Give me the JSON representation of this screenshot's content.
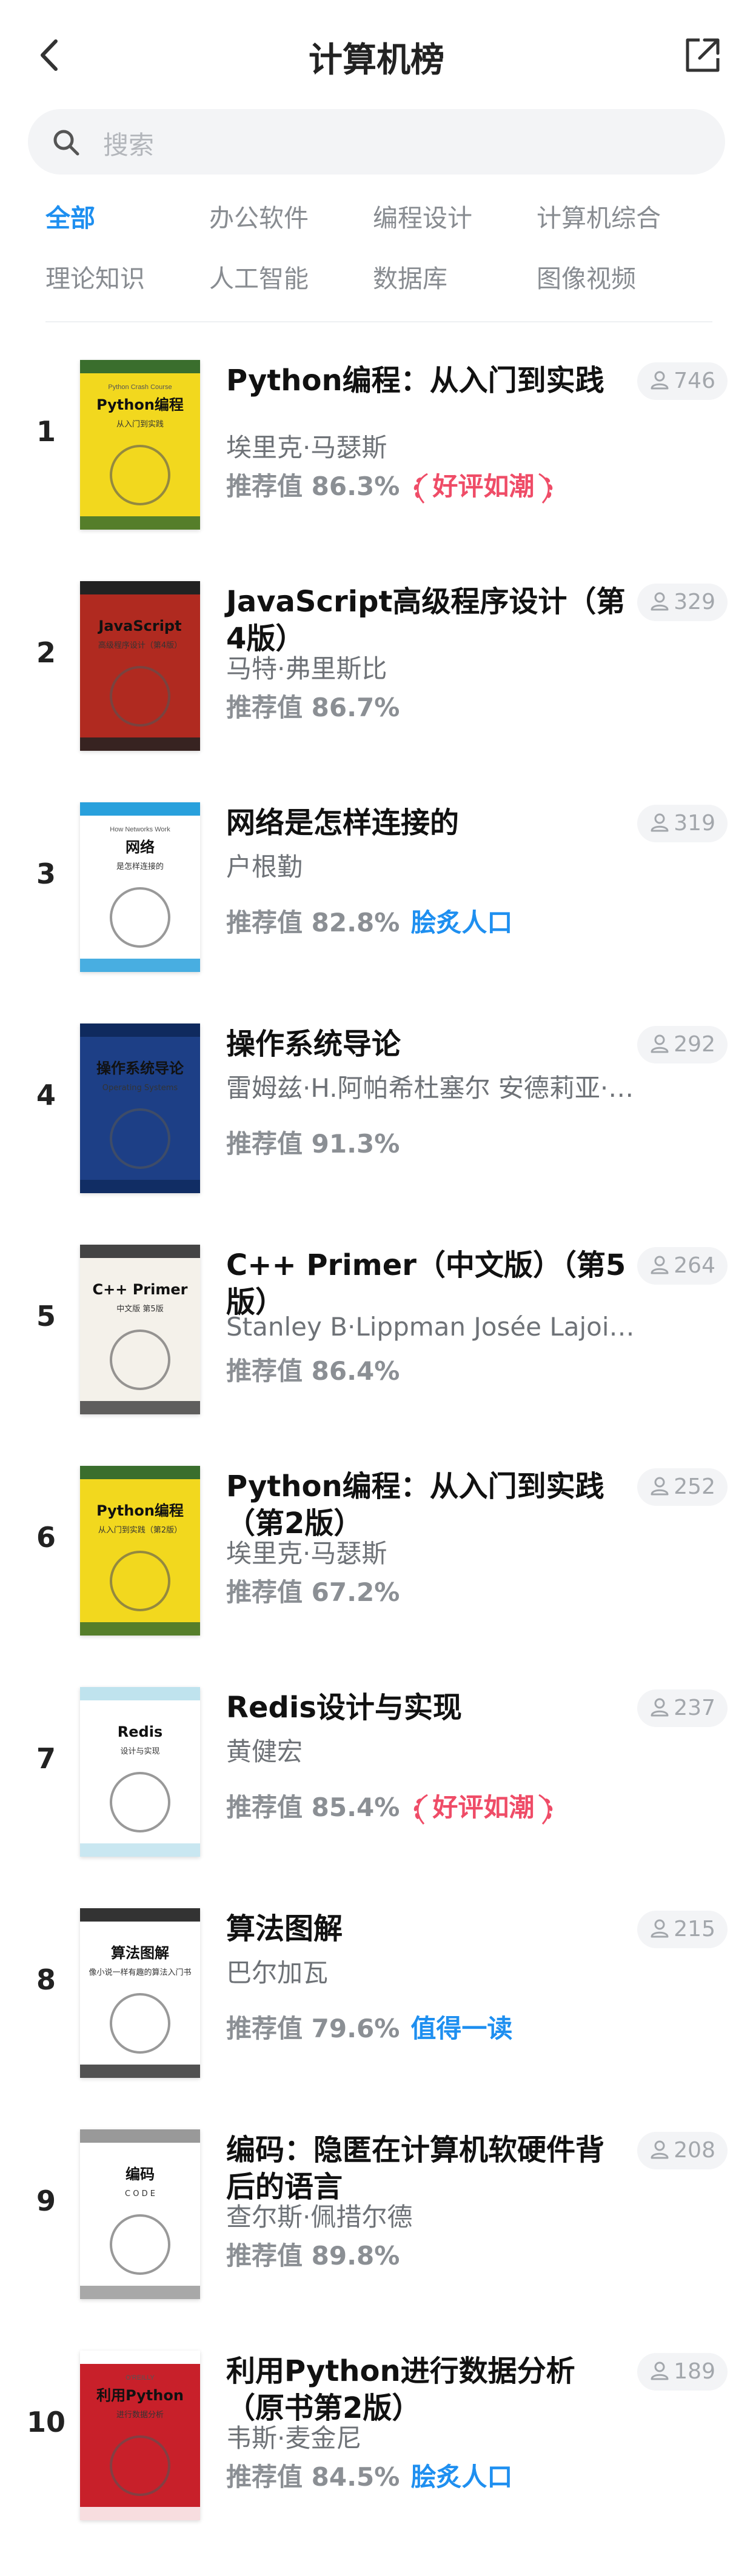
{
  "header": {
    "title": "计算机榜"
  },
  "search": {
    "placeholder": "搜索"
  },
  "categories": [
    "全部",
    "办公软件",
    "编程设计",
    "计算机综合",
    "理论知识",
    "人工智能",
    "数据库",
    "图像视频"
  ],
  "active_category": "全部",
  "books": [
    {
      "rank": "1",
      "title": "Python编程：从入门到实践",
      "author": "埃里克·马瑟斯",
      "score": "推荐值 86.3%",
      "tag": "好评如潮",
      "tag_style": "red",
      "readers": "746",
      "cover": {
        "bg": "#f2d81e",
        "band": "#3a6e2d",
        "title": "Python编程",
        "subtitle": "从入门到实践",
        "top": "Python Crash Course"
      }
    },
    {
      "rank": "2",
      "title": "JavaScript高级程序设计（第4版）",
      "author": "马特·弗里斯比",
      "score": "推荐值 86.7%",
      "tag": "",
      "tag_style": "",
      "readers": "329",
      "cover": {
        "bg": "#b02a20",
        "band": "#222",
        "title": "JavaScript",
        "subtitle": "高级程序设计（第4版）",
        "top": ""
      }
    },
    {
      "rank": "3",
      "title": "网络是怎样连接的",
      "author": "户根勤",
      "score": "推荐值 82.8%",
      "tag": "脍炙人口",
      "tag_style": "blue",
      "readers": "319",
      "cover": {
        "bg": "#ffffff",
        "band": "#28a0dc",
        "title": "网络",
        "subtitle": "是怎样连接的",
        "top": "How Networks Work"
      }
    },
    {
      "rank": "4",
      "title": "操作系统导论",
      "author": "雷姆兹·H.阿帕希杜塞尔 安德莉亚·C.阿帕希杜塞尔",
      "score": "推荐值 91.3%",
      "tag": "",
      "tag_style": "",
      "readers": "292",
      "cover": {
        "bg": "#1d3f86",
        "band": "#0f2a5e",
        "title": "操作系统导论",
        "subtitle": "Operating Systems",
        "top": ""
      }
    },
    {
      "rank": "5",
      "title": "C++ Primer（中文版）（第5版）",
      "author": "Stanley B·Lippman Josée Lajoie Barbara E·Moo",
      "score": "推荐值 86.4%",
      "tag": "",
      "tag_style": "",
      "readers": "264",
      "cover": {
        "bg": "#f4f1ea",
        "band": "#444",
        "title": "C++ Primer",
        "subtitle": "中文版 第5版",
        "top": ""
      }
    },
    {
      "rank": "6",
      "title": "Python编程：从入门到实践（第2版）",
      "author": "埃里克·马瑟斯",
      "score": "推荐值 67.2%",
      "tag": "",
      "tag_style": "",
      "readers": "252",
      "cover": {
        "bg": "#f2d81e",
        "band": "#3a6e2d",
        "title": "Python编程",
        "subtitle": "从入门到实践（第2版）",
        "top": ""
      }
    },
    {
      "rank": "7",
      "title": "Redis设计与实现",
      "author": "黄健宏",
      "score": "推荐值 85.4%",
      "tag": "好评如潮",
      "tag_style": "red",
      "readers": "237",
      "cover": {
        "bg": "#ffffff",
        "band": "#bfe3ee",
        "title": "Redis",
        "subtitle": "设计与实现",
        "top": ""
      }
    },
    {
      "rank": "8",
      "title": "算法图解",
      "author": "巴尔加瓦",
      "score": "推荐值 79.6%",
      "tag": "值得一读",
      "tag_style": "blue",
      "readers": "215",
      "cover": {
        "bg": "#ffffff",
        "band": "#333",
        "title": "算法图解",
        "subtitle": "像小说一样有趣的算法入门书",
        "top": ""
      }
    },
    {
      "rank": "9",
      "title": "编码：隐匿在计算机软硬件背后的语言",
      "author": "查尔斯·佩措尔德",
      "score": "推荐值 89.8%",
      "tag": "",
      "tag_style": "",
      "readers": "208",
      "cover": {
        "bg": "#ffffff",
        "band": "#999",
        "title": "编码",
        "subtitle": "C O D E",
        "top": ""
      }
    },
    {
      "rank": "10",
      "title": "利用Python进行数据分析（原书第2版）",
      "author": "韦斯·麦金尼",
      "score": "推荐值 84.5%",
      "tag": "脍炙人口",
      "tag_style": "blue",
      "readers": "189",
      "cover": {
        "bg": "#c8202a",
        "band": "#ffffff",
        "title": "利用Python",
        "subtitle": "进行数据分析",
        "top": "O'REILLY"
      }
    }
  ],
  "colors": {
    "accent": "#1e8ff0",
    "tag_red": "#ef4c67",
    "muted": "#8b8f94"
  }
}
